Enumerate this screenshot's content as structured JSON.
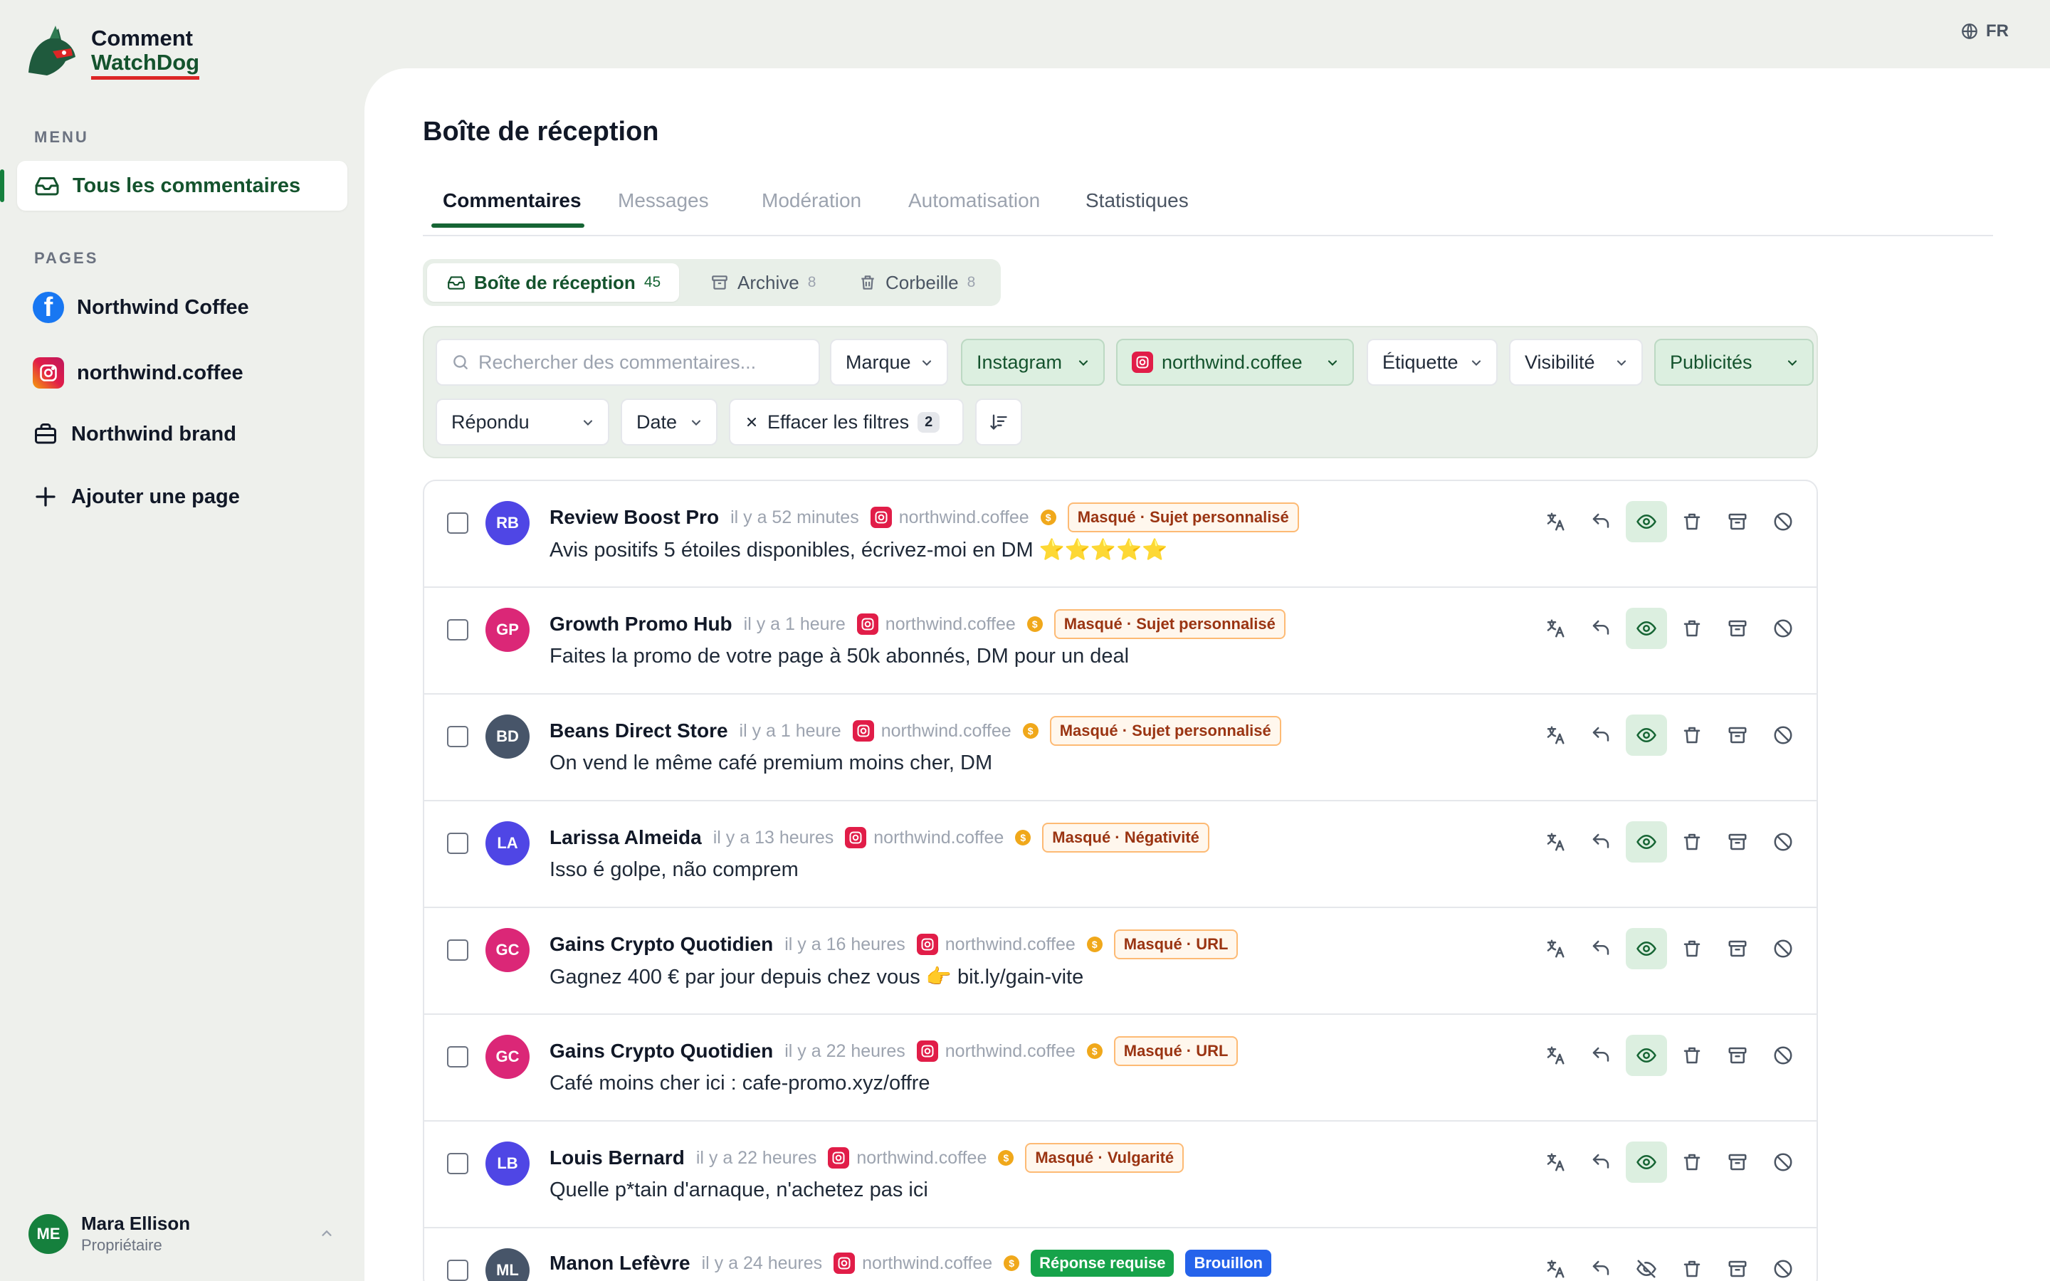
{
  "brand": {
    "line1": "Comment",
    "line2": "WatchDog"
  },
  "language": "FR",
  "sidebar": {
    "menu_label": "MENU",
    "menu_item": "Tous les commentaires",
    "pages_label": "PAGES",
    "pages": [
      {
        "label": "Northwind Coffee",
        "icon": "facebook-icon"
      },
      {
        "label": "northwind.coffee",
        "icon": "instagram-icon"
      },
      {
        "label": "Northwind brand",
        "icon": "briefcase-icon"
      }
    ],
    "add_page": "Ajouter une page"
  },
  "user": {
    "initials": "ME",
    "name": "Mara Ellison",
    "role": "Propriétaire"
  },
  "main": {
    "title": "Boîte de réception",
    "tabs": [
      "Commentaires",
      "Messages",
      "Modération",
      "Automatisation",
      "Statistiques"
    ],
    "subtabs": [
      {
        "label": "Boîte de réception",
        "count": "45"
      },
      {
        "label": "Archive",
        "count": "8"
      },
      {
        "label": "Corbeille",
        "count": "8"
      }
    ]
  },
  "filters": {
    "search_placeholder": "Rechercher des commentaires...",
    "brand": "Marque",
    "platform": "Instagram",
    "account": "northwind.coffee",
    "label": "Étiquette",
    "visibility": "Visibilité",
    "ads": "Publicités",
    "replied": "Répondu",
    "date": "Date",
    "clear": "Effacer les filtres",
    "clear_count": "2"
  },
  "comments": [
    {
      "initials": "RB",
      "color": "#4f46e5",
      "author": "Review Boost Pro",
      "ago": "il y a 52 minutes",
      "account": "northwind.coffee",
      "tags": [
        "Masqué · Sujet personnalisé"
      ],
      "text": "Avis positifs 5 étoiles disponibles, écrivez-moi en DM ⭐⭐⭐⭐⭐",
      "hidden": true
    },
    {
      "initials": "GP",
      "color": "#db2777",
      "author": "Growth Promo Hub",
      "ago": "il y a 1 heure",
      "account": "northwind.coffee",
      "tags": [
        "Masqué · Sujet personnalisé"
      ],
      "text": "Faites la promo de votre page à 50k abonnés, DM pour un deal",
      "hidden": true
    },
    {
      "initials": "BD",
      "color": "#475569",
      "author": "Beans Direct Store",
      "ago": "il y a 1 heure",
      "account": "northwind.coffee",
      "tags": [
        "Masqué · Sujet personnalisé"
      ],
      "text": "On vend le même café premium moins cher, DM",
      "hidden": true
    },
    {
      "initials": "LA",
      "color": "#4f46e5",
      "author": "Larissa Almeida",
      "ago": "il y a 13 heures",
      "account": "northwind.coffee",
      "tags": [
        "Masqué · Négativité"
      ],
      "text": "Isso é golpe, não comprem",
      "hidden": true
    },
    {
      "initials": "GC",
      "color": "#db2777",
      "author": "Gains Crypto Quotidien",
      "ago": "il y a 16 heures",
      "account": "northwind.coffee",
      "tags": [
        "Masqué · URL"
      ],
      "text": "Gagnez 400 € par jour depuis chez vous 👉 bit.ly/gain-vite",
      "hidden": true
    },
    {
      "initials": "GC",
      "color": "#db2777",
      "author": "Gains Crypto Quotidien",
      "ago": "il y a 22 heures",
      "account": "northwind.coffee",
      "tags": [
        "Masqué · URL"
      ],
      "text": "Café moins cher ici : cafe-promo.xyz/offre",
      "hidden": true
    },
    {
      "initials": "LB",
      "color": "#4f46e5",
      "author": "Louis Bernard",
      "ago": "il y a 22 heures",
      "account": "northwind.coffee",
      "tags": [
        "Masqué · Vulgarité"
      ],
      "text": "Quelle p*tain d'arnaque, n'achetez pas ici",
      "hidden": true
    },
    {
      "initials": "ML",
      "color": "#475569",
      "author": "Manon Lefèvre",
      "ago": "il y a 24 heures",
      "account": "northwind.coffee",
      "tags": [
        "Réponse requise",
        "Brouillon"
      ],
      "text": "",
      "hidden": false
    }
  ],
  "colors": {
    "accent": "#166534",
    "background": "#eef0ec",
    "warn_tag": "#9a3412",
    "instagram": "#e11d48"
  }
}
